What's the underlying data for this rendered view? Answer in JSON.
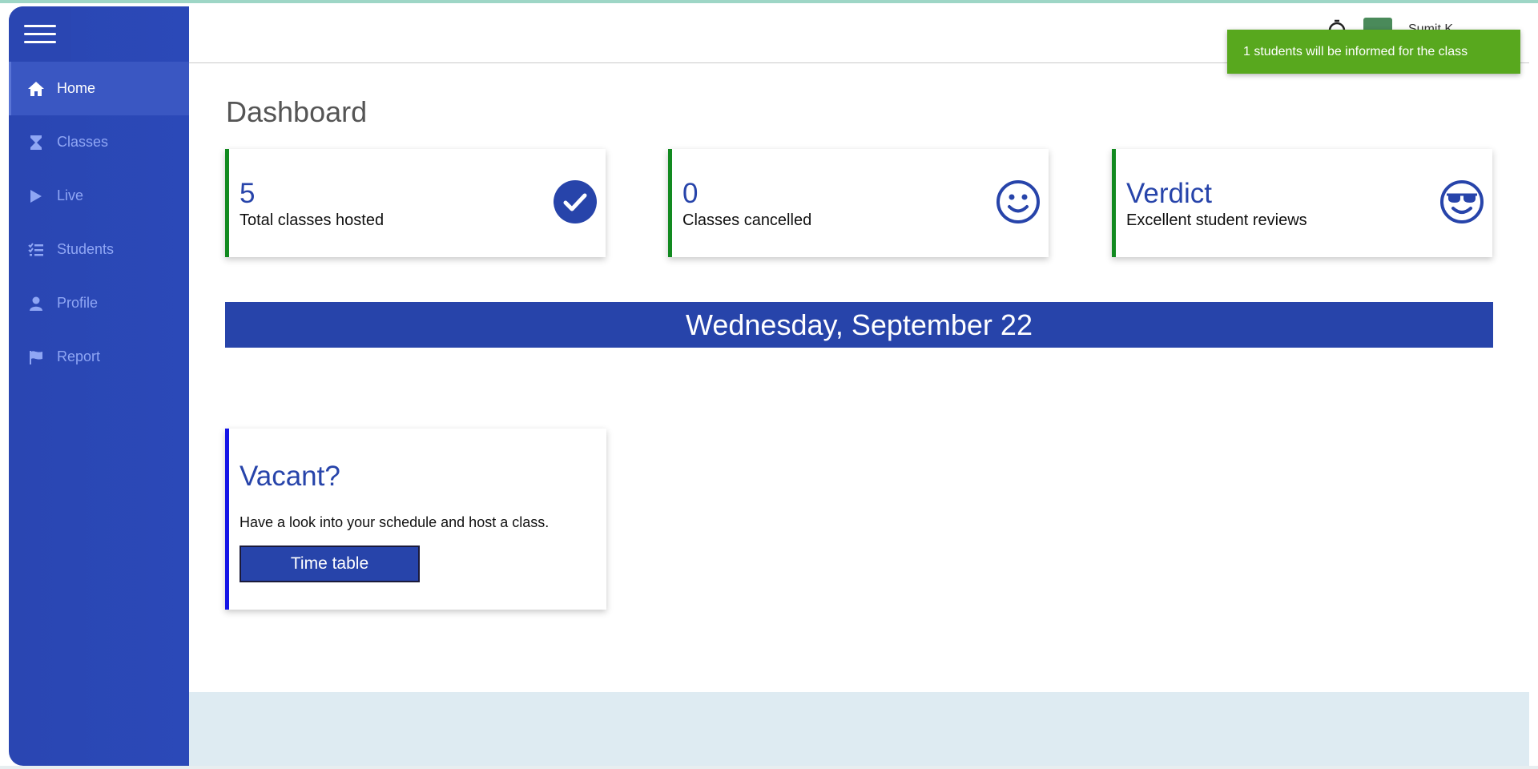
{
  "sidebar": {
    "items": [
      {
        "label": "Home",
        "icon": "home-icon",
        "active": true
      },
      {
        "label": "Classes",
        "icon": "hourglass-icon",
        "active": false
      },
      {
        "label": "Live",
        "icon": "play-icon",
        "active": false
      },
      {
        "label": "Students",
        "icon": "checklist-icon",
        "active": false
      },
      {
        "label": "Profile",
        "icon": "user-icon",
        "active": false
      },
      {
        "label": "Report",
        "icon": "flag-icon",
        "active": false
      }
    ]
  },
  "header": {
    "user_name": "Sumit K..."
  },
  "dashboard": {
    "title": "Dashboard",
    "cards": [
      {
        "value": "5",
        "label": "Total classes hosted",
        "icon": "check-circle-icon"
      },
      {
        "value": "0",
        "label": "Classes cancelled",
        "icon": "smiley-icon"
      },
      {
        "value": "Verdict",
        "label": "Excellent student reviews",
        "icon": "sunglasses-smiley-icon"
      }
    ],
    "date_banner": "Wednesday, September 22",
    "vacant": {
      "title": "Vacant?",
      "text": "Have a look into your schedule and host a class.",
      "button": "Time table"
    }
  },
  "toast": {
    "message": "1 students will be informed for the class"
  },
  "colors": {
    "primary": "#2744aa",
    "sidebar": "#2a46b2",
    "card_accent": "#128a20",
    "vacant_accent": "#1414e6",
    "toast": "#58a81e"
  }
}
